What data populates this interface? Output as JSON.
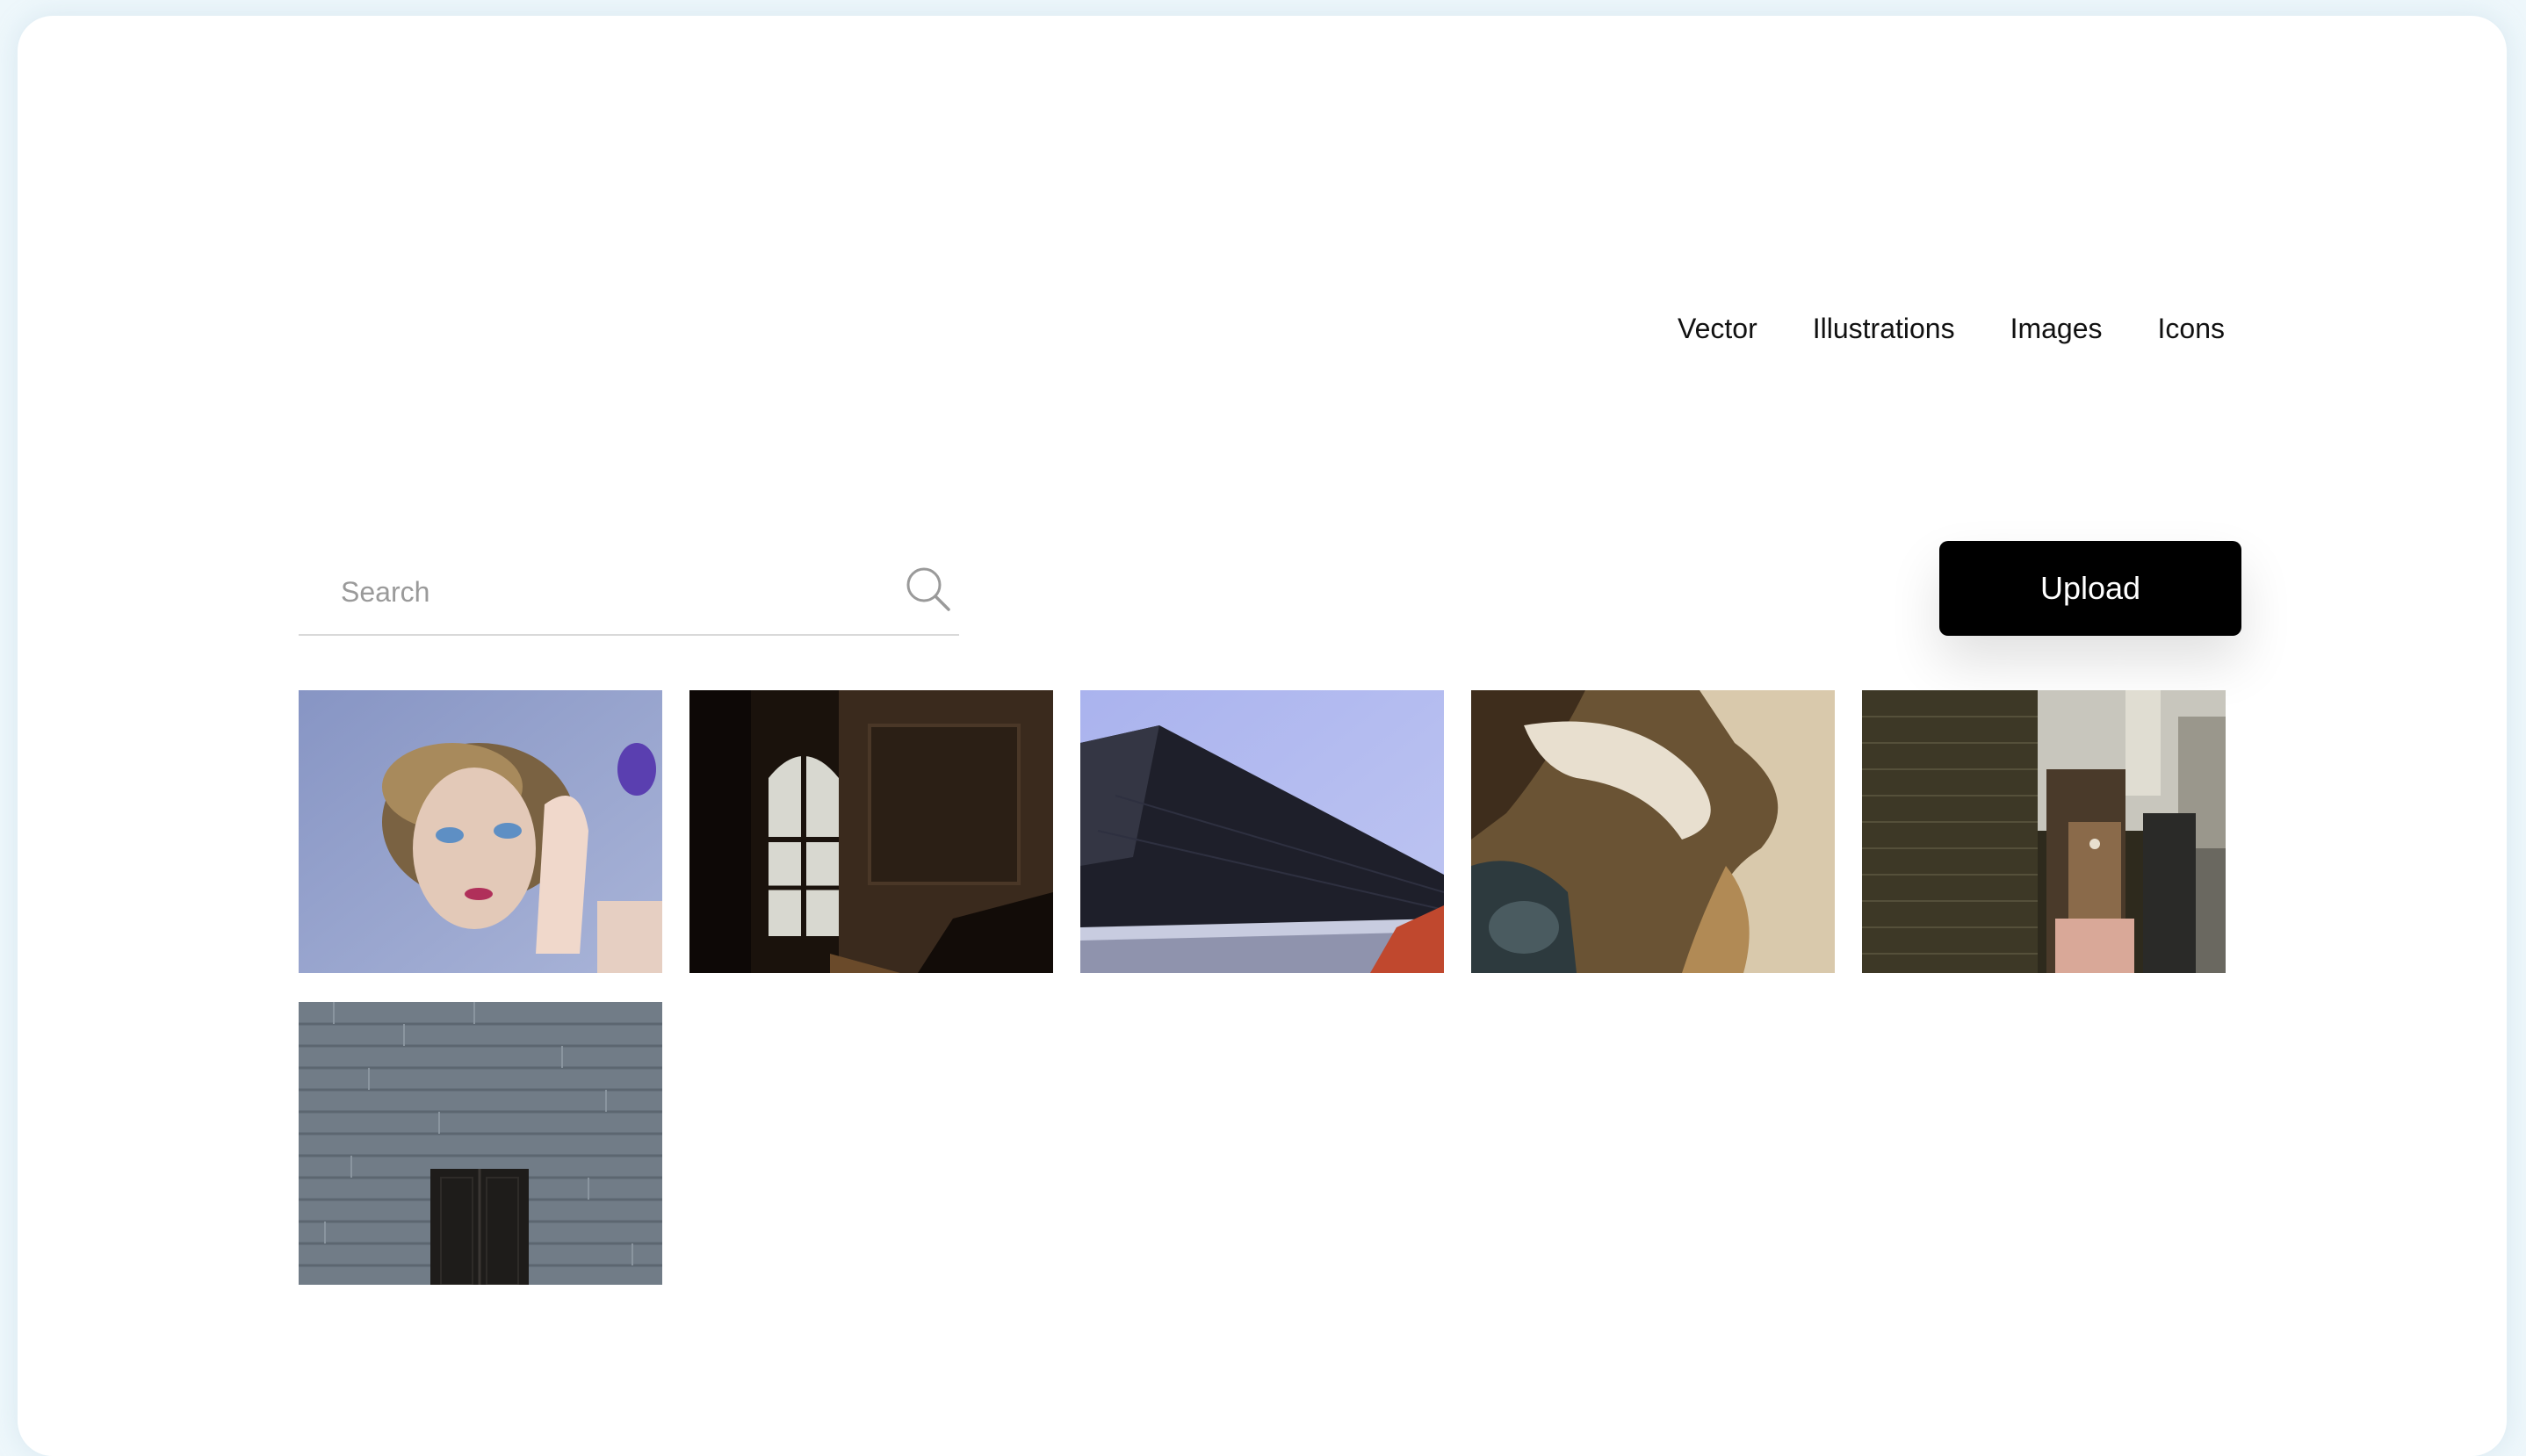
{
  "nav": {
    "items": [
      {
        "label": "Vector"
      },
      {
        "label": "Illustrations"
      },
      {
        "label": "Images"
      },
      {
        "label": "Icons"
      }
    ]
  },
  "search": {
    "placeholder": "Search",
    "value": "",
    "icon": "search-icon"
  },
  "upload": {
    "label": "Upload"
  },
  "gallery": {
    "images": [
      {
        "subject": "portrait-with-blue-eyeshadow"
      },
      {
        "subject": "dark-room-with-window"
      },
      {
        "subject": "angular-building-roof-and-sky"
      },
      {
        "subject": "aerial-sand-river-patterns"
      },
      {
        "subject": "dense-highrise-buildings"
      },
      {
        "subject": "stone-wall-with-door"
      }
    ]
  },
  "colors": {
    "page_background": "#eef7fb",
    "card_background": "#ffffff",
    "button_background": "#000000",
    "button_text": "#ffffff"
  }
}
